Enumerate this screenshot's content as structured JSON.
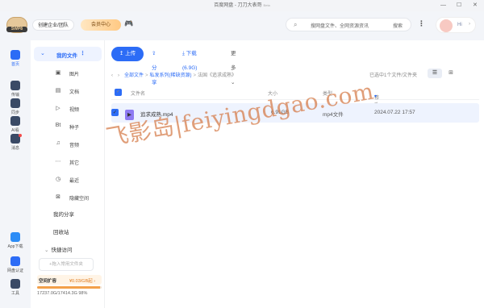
{
  "window": {
    "title": "百度网盘 - 刀刀大表哥",
    "beta": "Beta",
    "minimize": "—",
    "maximize": "☐",
    "close": "✕"
  },
  "topbar": {
    "avatar_badge": "SWP8",
    "corp_button": "创建企业/团队",
    "vip_button": "会员中心",
    "game_icon": "gamepad-icon",
    "search_placeholder": "搜网盘文件、全网资源资讯",
    "search_button": "搜索",
    "more": "⋮",
    "user_greeting": "Hi",
    "user_chevron": "›"
  },
  "leftbar": [
    {
      "label": "首页",
      "icon": "home-icon",
      "color": "#2c6cf6",
      "active": true
    },
    {
      "label": "传输",
      "icon": "transfer-icon",
      "color": "#3a4a66"
    },
    {
      "label": "同步",
      "icon": "sync-icon",
      "color": "#3a4a66"
    },
    {
      "label": "AI看",
      "icon": "ai-icon",
      "color": "#3a4a66"
    },
    {
      "label": "消息",
      "icon": "message-icon",
      "color": "#3a4a66"
    },
    {
      "label": "App下载",
      "icon": "app-download-icon",
      "color": "#2c8cf6"
    },
    {
      "label": "网盘认证",
      "icon": "verify-icon",
      "color": "#2c6cf6"
    },
    {
      "label": "工具",
      "icon": "tools-icon",
      "color": "#3a4a66"
    }
  ],
  "sidebar": {
    "my_files": "我的文件",
    "my_files_more": "⋮",
    "categories": [
      {
        "label": "图片",
        "glyph": "▣"
      },
      {
        "label": "文档",
        "glyph": "▤"
      },
      {
        "label": "视频",
        "glyph": "▷"
      },
      {
        "label": "种子",
        "glyph": "Bt"
      },
      {
        "label": "音频",
        "glyph": "♫"
      },
      {
        "label": "其它",
        "glyph": "⋯"
      },
      {
        "label": "最近",
        "glyph": "◷"
      },
      {
        "label": "隐藏空间",
        "glyph": "⊠"
      }
    ],
    "my_share": "我的分享",
    "recycle": "回收站",
    "quick_access": "快捷访问",
    "quick_chevron": "⌄",
    "add_quick": "+拖入常用文件夹",
    "storage_label": "空间扩容",
    "storage_price": "¥0.03/GB起 ›",
    "usage_text": "17237.0G/17414.3G 98%",
    "usage_fraction": 0.98
  },
  "toolbar": {
    "upload": "上传",
    "upload_icon": "↥",
    "share": "分享",
    "share_icon": "⇪",
    "download": "下载(6.9G)",
    "download_icon": "⤓",
    "more": "更多",
    "more_icon": "⌄"
  },
  "breadcrumb": {
    "back": "‹",
    "forward": "›",
    "root": "全部文件",
    "folder": "私发系列(稀缺资源)",
    "current": "法国《追求成熟》",
    "sep": ">"
  },
  "loaded_info": "已选中1个文件/文件夹",
  "view_list": "☰",
  "view_grid": "⊞",
  "table": {
    "headers": {
      "name": "文件名",
      "size": "大小",
      "type": "类型",
      "modified": "修改时间",
      "sort_icon": "▾"
    },
    "rows": [
      {
        "name": "追求成熟.mp4",
        "size": "6.91GB",
        "type": "mp4文件",
        "modified": "2024.07.22 17:57",
        "icon": "▶"
      }
    ]
  },
  "check": "✓",
  "watermark": "飞影岛|feiyingdgao.com"
}
